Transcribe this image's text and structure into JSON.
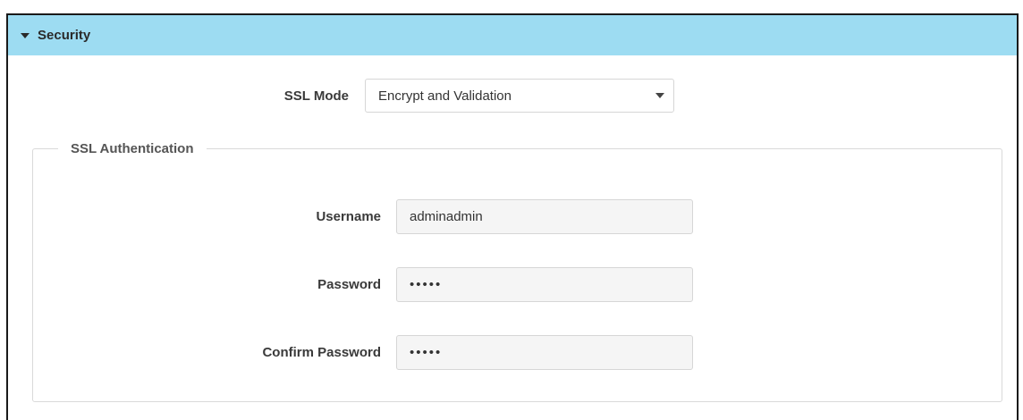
{
  "section": {
    "title": "Security",
    "expanded": true,
    "header_color": "#9ddcf2",
    "icon": "caret-down-icon"
  },
  "ssl_mode": {
    "label": "SSL Mode",
    "selected": "Encrypt and Validation"
  },
  "ssl_auth": {
    "legend": "SSL Authentication",
    "username": {
      "label": "Username",
      "value": "adminadmin"
    },
    "password": {
      "label": "Password",
      "value": "•••••"
    },
    "confirm_password": {
      "label": "Confirm Password",
      "value": "•••••"
    }
  }
}
